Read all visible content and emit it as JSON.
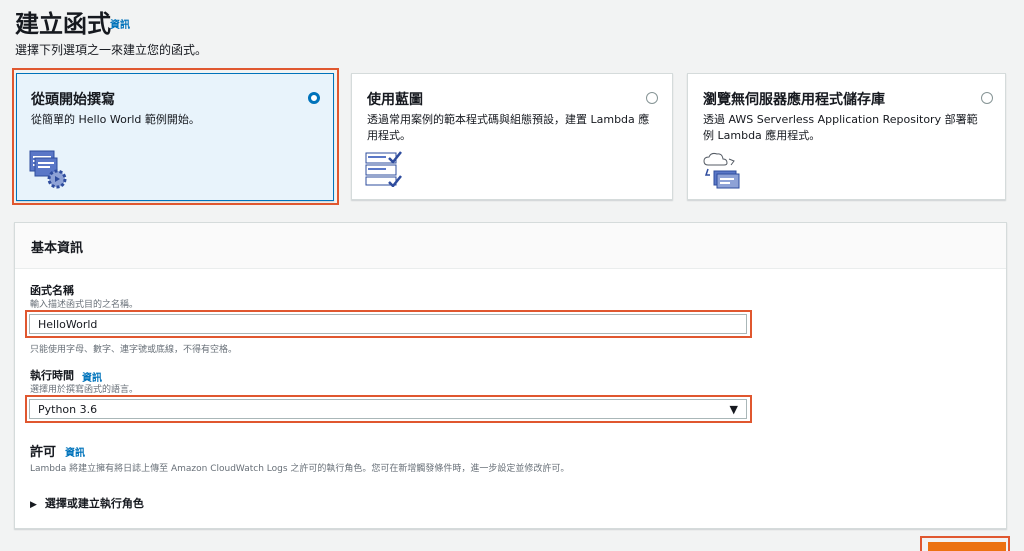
{
  "header": {
    "title": "建立函式",
    "info": "資訊",
    "subtitle": "選擇下列選項之一來建立您的函式。"
  },
  "options": [
    {
      "title": "從頭開始撰寫",
      "desc": "從簡單的 Hello World 範例開始。",
      "selected": true,
      "icon": "author-from-scratch-icon"
    },
    {
      "title": "使用藍圖",
      "desc": "透過常用案例的範本程式碼與組態預設，建置 Lambda 應用程式。",
      "selected": false,
      "icon": "blueprint-icon"
    },
    {
      "title": "瀏覽無伺服器應用程式儲存庫",
      "desc": "透過 AWS Serverless Application Repository 部署範例 Lambda 應用程式。",
      "selected": false,
      "icon": "serverless-repo-icon"
    }
  ],
  "basic": {
    "title": "基本資訊",
    "name_label": "函式名稱",
    "name_hint": "輸入描述函式目的之名稱。",
    "name_value": "HelloWorld",
    "name_constraint": "只能使用字母、數字、連字號或底線，不得有空格。",
    "runtime_label": "執行時間",
    "runtime_info": "資訊",
    "runtime_hint": "選擇用於撰寫函式的語言。",
    "runtime_value": "Python 3.6",
    "perm_title": "許可",
    "perm_info": "資訊",
    "perm_desc": "Lambda 將建立擁有將日誌上傳至 Amazon CloudWatch Logs 之許可的執行角色。您可在新增觸發條件時，進一步設定並修改許可。",
    "role_toggle": "選擇或建立執行角色"
  },
  "colors": {
    "accent": "#0073bb",
    "highlight": "#e0572f",
    "primary_button": "#ec7211"
  }
}
